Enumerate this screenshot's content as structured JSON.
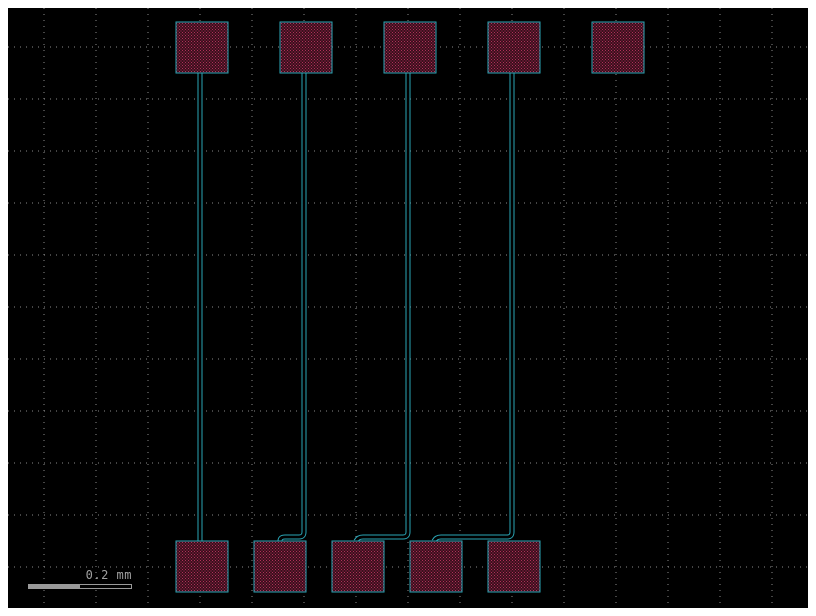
{
  "scale_bar": {
    "label": "0.2 mm",
    "fill_fraction": 0.5
  },
  "colors": {
    "background": "#000000",
    "grid_dot": "#8a8a8a",
    "pad_fill": "#5a1528",
    "pad_outline": "#2aa6b6",
    "trace_outline": "#2aa6b6"
  },
  "icons": [
    "pad-icon",
    "trace-icon"
  ]
}
